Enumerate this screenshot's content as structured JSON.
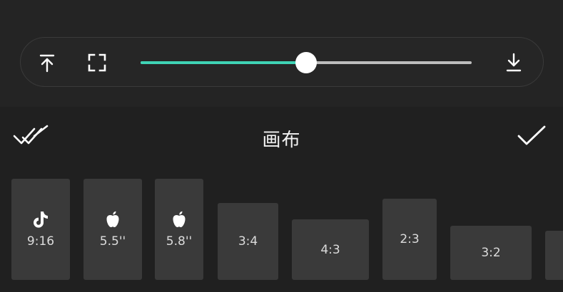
{
  "colors": {
    "accent": "#3fd3b5",
    "track": "#bdbdbd",
    "card": "#3a3a3a"
  },
  "toolbar": {
    "left_icons": [
      "align-top-icon",
      "fullscreen-icon"
    ],
    "right_icon": "download-icon",
    "slider_fraction": 0.5
  },
  "panel": {
    "title": "画布",
    "left_icon": "apply-all-icon",
    "right_icon": "confirm-check-icon"
  },
  "ratios": [
    {
      "label": "9:16",
      "icon": "tiktok-icon"
    },
    {
      "label": "5.5''",
      "icon": "apple-icon"
    },
    {
      "label": "5.8''",
      "icon": "apple-icon"
    },
    {
      "label": "3:4"
    },
    {
      "label": "4:3"
    },
    {
      "label": "2:3"
    },
    {
      "label": "3:2"
    },
    {
      "label": ""
    }
  ]
}
